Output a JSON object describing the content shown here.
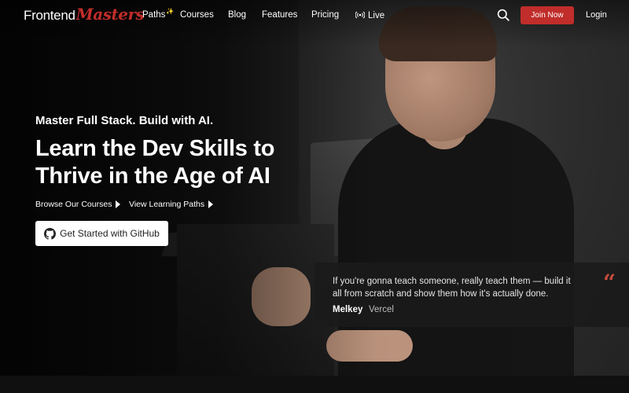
{
  "brand": {
    "part1": "Frontend",
    "part2": "Masters",
    "accent": "#c02d2a"
  },
  "nav": {
    "items": [
      {
        "label": "Paths",
        "sparkle": "✨"
      },
      {
        "label": "Courses"
      },
      {
        "label": "Blog"
      },
      {
        "label": "Features"
      },
      {
        "label": "Pricing"
      },
      {
        "label": "Live",
        "icon": "broadcast-icon"
      }
    ],
    "search_icon": "search-icon",
    "join_label": "Join Now",
    "login_label": "Login"
  },
  "hero": {
    "eyebrow": "Master Full Stack. Build with AI.",
    "headline": "Learn the Dev Skills to Thrive in the Age of AI",
    "links": [
      {
        "label": "Browse Our Courses"
      },
      {
        "label": "View Learning Paths"
      }
    ],
    "github_button": {
      "label": "Get Started with GitHub",
      "icon": "github-icon"
    }
  },
  "testimonial": {
    "quote": "If you're gonna teach someone, really teach them — build it all from scratch and show them how it's actually done.",
    "name": "Melkey",
    "company": "Vercel",
    "quote_color": "#c64a3c"
  }
}
